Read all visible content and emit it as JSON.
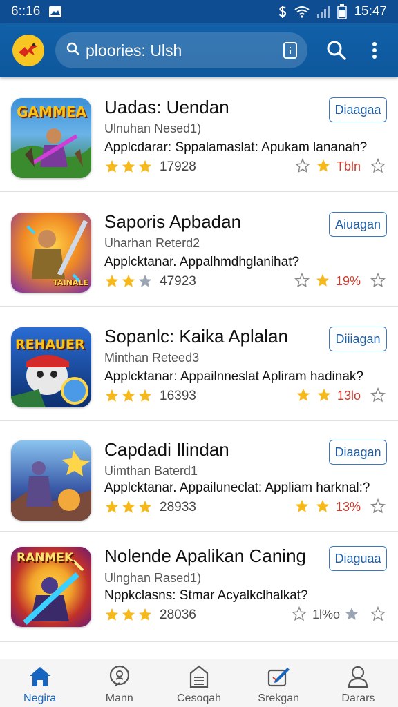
{
  "status_bar": {
    "time_left": "6::16",
    "time_right": "15:47"
  },
  "app_bar": {
    "search_value": "ploories: Ulsh",
    "colors": {
      "bar": "#0e579c",
      "logo_bg": "#f7c623"
    },
    "icons": [
      "app-logo-icon",
      "search-icon",
      "document-icon",
      "more-vert-icon"
    ]
  },
  "apps": [
    {
      "title": "Uadas: Uendan",
      "developer": "Ulnuhan Nesed1)",
      "description": "Applcdarar: Sppalamaslat: Apukam lananah?",
      "rating_count": "17928",
      "stars": 3,
      "percent": "Tbln",
      "action": "Diaagaa",
      "icon_text": "GAMMEA",
      "icon_bg": [
        "#3b8fd6",
        "#2d7a35"
      ]
    },
    {
      "title": "Saporis Apbadan",
      "developer": "Uharhan Reterd2",
      "description": "Applcktanar. Appalhmdhglanihat?",
      "rating_count": "47923",
      "stars": 2.5,
      "percent": "19%",
      "action": "Aiuagan",
      "icon_text": "TAINALE",
      "icon_bg": [
        "#f08a24",
        "#7a2aa8"
      ]
    },
    {
      "title": "Sopanlc: Kaika Aplalan",
      "developer": "Minthan Reteed3",
      "description": "Applcktanar: Appailnneslat Apliram hadinak?",
      "rating_count": "16393",
      "stars": 3,
      "percent": "13lo",
      "action": "Diiiagan",
      "icon_text": "REHAUER",
      "icon_bg": [
        "#1f58b8",
        "#0d2f6e"
      ]
    },
    {
      "title": "Capdadi Ilindan",
      "developer": "Uimthan Baterd1",
      "description": "Applcktanar. Appailuneclat: Appliam harknal:?",
      "rating_count": "28933",
      "stars": 3,
      "percent": "13%",
      "action": "Diaagan",
      "icon_text": "",
      "icon_bg": [
        "#5aa6e8",
        "#2a3d8a"
      ]
    },
    {
      "title": "Nolende Apalikan Caning",
      "developer": "Ulnghan Rased1)",
      "description": "Nppkclasns: Stmar Acyalkclhalkat?",
      "rating_count": "28036",
      "stars": 3,
      "percent": "1l%o",
      "action": "Diaguaa",
      "icon_text": "RANMEK",
      "icon_bg": [
        "#f2a52a",
        "#6a1a78"
      ]
    }
  ],
  "bottom_nav": [
    {
      "label": "Negira",
      "icon": "home-icon",
      "active": true
    },
    {
      "label": "Mann",
      "icon": "chat-icon",
      "active": false
    },
    {
      "label": "Cesoqah",
      "icon": "document-icon",
      "active": false
    },
    {
      "label": "Srekgan",
      "icon": "edit-icon",
      "active": false
    },
    {
      "label": "Darars",
      "icon": "person-icon",
      "active": false
    }
  ]
}
